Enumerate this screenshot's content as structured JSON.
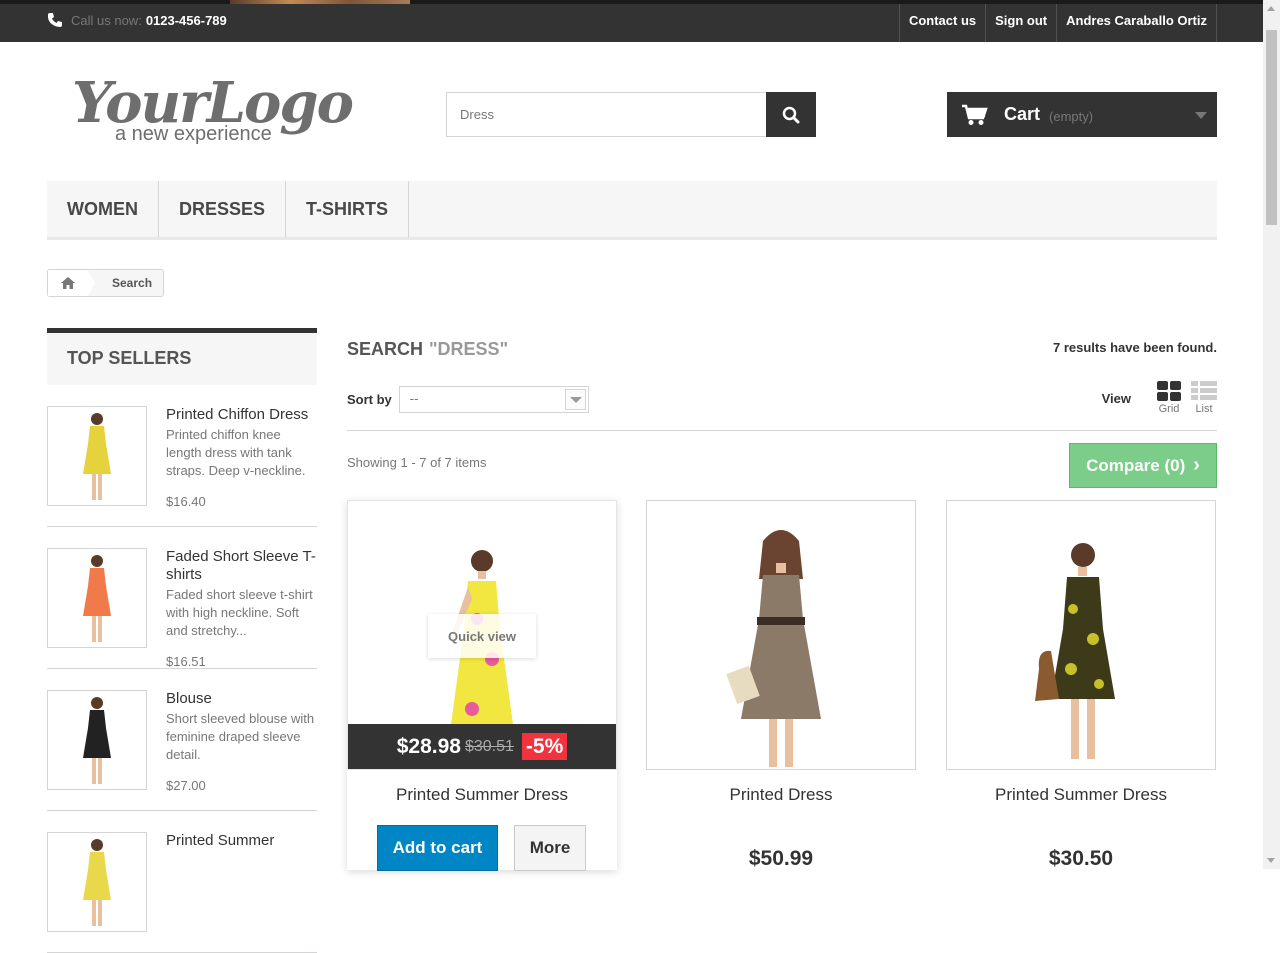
{
  "topbar": {
    "call_label": "Call us now:",
    "phone": "0123-456-789",
    "links": [
      "Contact us",
      "Sign out",
      "Andres Caraballo Ortiz"
    ]
  },
  "logo": {
    "main": "YourLogo",
    "tagline": "a new experience"
  },
  "search": {
    "value": "Dress"
  },
  "cart": {
    "label": "Cart",
    "status": "(empty)"
  },
  "menu": [
    "WOMEN",
    "DRESSES",
    "T-SHIRTS"
  ],
  "breadcrumb": {
    "current": "Search"
  },
  "sidebar": {
    "title": "TOP SELLERS",
    "items": [
      {
        "name": "Printed Chiffon Dress",
        "desc": "Printed chiffon knee length dress with tank straps. Deep v-neckline.",
        "price": "$16.40",
        "color": "#e6d23a"
      },
      {
        "name": "Faded Short Sleeve T-shirts",
        "desc": "Faded short sleeve t-shirt with high neckline. Soft and stretchy...",
        "price": "$16.51",
        "color": "#f07a4a"
      },
      {
        "name": "Blouse",
        "desc": "Short sleeved blouse with feminine draped sleeve detail.",
        "price": "$27.00",
        "color": "#222222"
      },
      {
        "name": "Printed Summer",
        "desc": "",
        "price": "",
        "color": "#e8d84a"
      }
    ]
  },
  "content": {
    "heading": "SEARCH",
    "query": "\"DRESS\"",
    "results": "7 results have been found.",
    "sort_label": "Sort by",
    "sort_value": "--",
    "view_label": "View",
    "view_grid": "Grid",
    "view_list": "List",
    "showing": "Showing 1 - 7 of 7 items",
    "compare": "Compare (0)"
  },
  "products": [
    {
      "name": "Printed Summer Dress",
      "price": "$28.98",
      "old_price": "$30.51",
      "discount": "-5%",
      "quick_view": "Quick view",
      "add_to_cart": "Add to cart",
      "more": "More",
      "dress_color": "#f2e640",
      "accent": "#e85a9a"
    },
    {
      "name": "Printed Dress",
      "price": "$50.99",
      "dress_color": "#8c7a68",
      "accent": "#3a2e26"
    },
    {
      "name": "Printed Summer Dress",
      "price": "$30.50",
      "dress_color": "#3c3a18",
      "accent": "#c8c02a"
    }
  ]
}
